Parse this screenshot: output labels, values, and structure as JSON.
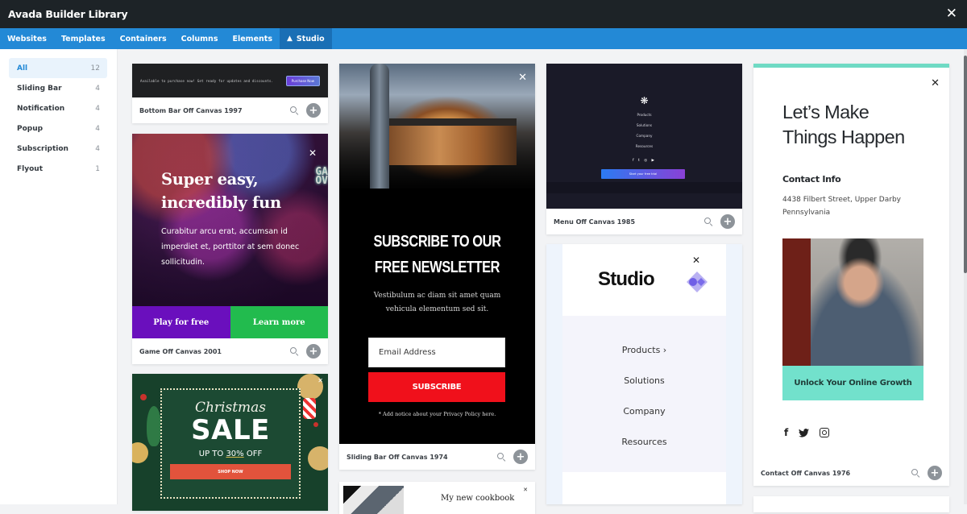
{
  "window": {
    "title": "Avada Builder Library",
    "close_icon": "close-icon"
  },
  "tabs": [
    {
      "label": "Websites",
      "active": false
    },
    {
      "label": "Templates",
      "active": false
    },
    {
      "label": "Containers",
      "active": false
    },
    {
      "label": "Columns",
      "active": false
    },
    {
      "label": "Elements",
      "active": false
    },
    {
      "label": "Studio",
      "active": true,
      "icon": "avada-logo-icon"
    }
  ],
  "sidebar": {
    "items": [
      {
        "label": "All",
        "count": "12",
        "active": true
      },
      {
        "label": "Sliding Bar",
        "count": "4"
      },
      {
        "label": "Notification",
        "count": "4"
      },
      {
        "label": "Popup",
        "count": "4"
      },
      {
        "label": "Subscription",
        "count": "4"
      },
      {
        "label": "Flyout",
        "count": "1"
      }
    ]
  },
  "colors": {
    "accent": "#2389d6",
    "active_tab": "#1a6fb5",
    "titlebar": "#1d2327"
  },
  "cards": {
    "bottom_bar": {
      "name": "Bottom Bar Off Canvas 1997",
      "announcement": "Available to purchase now! Get ready for updates and discounts.",
      "button": "Purchase Now"
    },
    "game": {
      "name": "Game Off Canvas 2001",
      "heading_line1": "Super easy,",
      "heading_line2": "incredibly fun",
      "body": "Curabitur arcu erat, accumsan id imperdiet et, porttitor at sem donec sollicitudin.",
      "play_label": "Play for free",
      "learn_label": "Learn more",
      "sign": "GA\nOV"
    },
    "christmas": {
      "script": "Christmas",
      "sale": "SALE",
      "offer_prefix": "UP TO ",
      "offer_pct": "30%",
      "offer_suffix": " OFF",
      "shop_label": "SHOP NOW"
    },
    "sliding_bar": {
      "name": "Sliding Bar Off Canvas 1974",
      "heading_line1": "SUBSCRIBE TO OUR",
      "heading_line2": "FREE NEWSLETTER",
      "body_line1": "Vestibulum ac diam sit amet quam",
      "body_line2": "vehicula elementum sed sit.",
      "email_placeholder": "Email Address",
      "subscribe_label": "SUBSCRIBE",
      "notice": "* Add notice about your Privacy Policy here."
    },
    "cookbook": {
      "title": "My new cookbook"
    },
    "menu": {
      "name": "Menu Off Canvas 1985",
      "items": [
        "Products",
        "Solutions",
        "Company",
        "Resources"
      ],
      "social": "f  t  ◎  ▶",
      "trial_label": "Start your free trial"
    },
    "studio": {
      "logo": "Studio",
      "items": [
        "Products",
        "Solutions",
        "Company",
        "Resources"
      ],
      "chevron": "›"
    },
    "contact": {
      "name": "Contact Off Canvas 1976",
      "heading_line1": "Let’s Make",
      "heading_line2": "Things Happen",
      "contact_title": "Contact Info",
      "address_line1": "4438 Filbert Street, Upper Darby",
      "address_line2": "Pennsylvania",
      "cta": "Unlock Your Online Growth"
    }
  }
}
